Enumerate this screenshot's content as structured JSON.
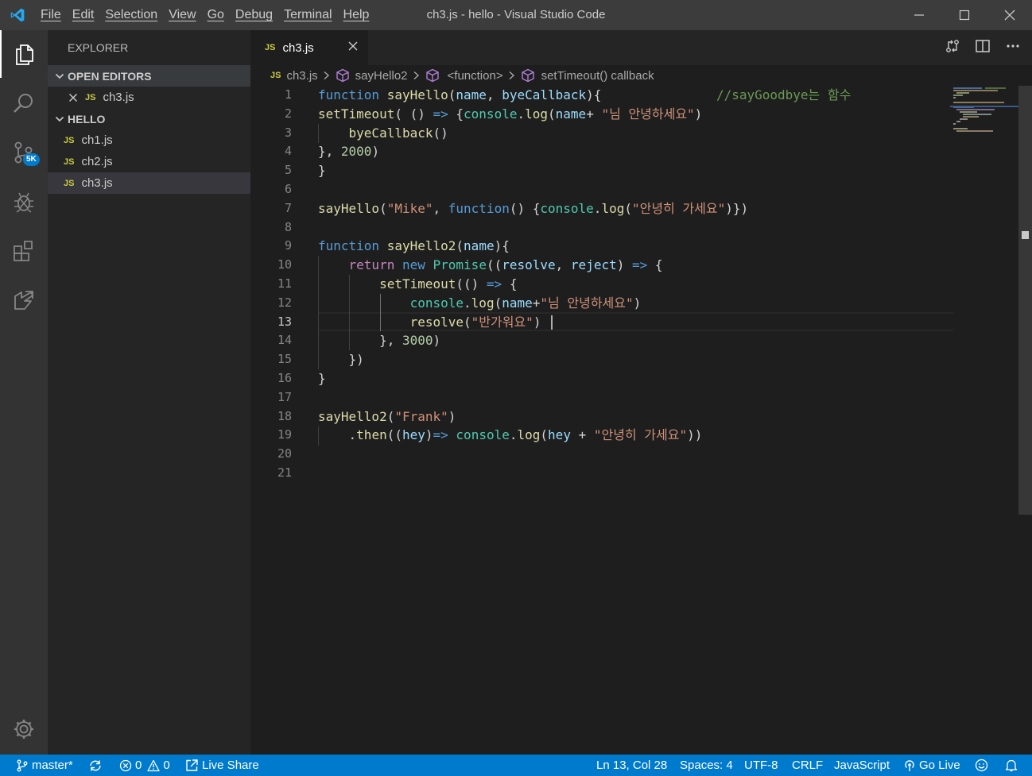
{
  "window": {
    "title": "ch3.js - hello - Visual Studio Code"
  },
  "menu": [
    "File",
    "Edit",
    "Selection",
    "View",
    "Go",
    "Debug",
    "Terminal",
    "Help"
  ],
  "activity": {
    "scm_badge": "5K"
  },
  "sidebar": {
    "title": "EXPLORER",
    "open_editors_label": "OPEN EDITORS",
    "open_editors": [
      {
        "badge": "JS",
        "name": "ch3.js"
      }
    ],
    "folder_label": "HELLO",
    "files": [
      {
        "badge": "JS",
        "name": "ch1.js"
      },
      {
        "badge": "JS",
        "name": "ch2.js"
      },
      {
        "badge": "JS",
        "name": "ch3.js"
      }
    ]
  },
  "tab": {
    "badge": "JS",
    "label": "ch3.js"
  },
  "breadcrumb": {
    "file": "ch3.js",
    "items": [
      "sayHello2",
      "<function>",
      "setTimeout() callback"
    ]
  },
  "editor": {
    "line_numbers": [
      "1",
      "2",
      "3",
      "4",
      "5",
      "6",
      "7",
      "8",
      "9",
      "10",
      "11",
      "12",
      "13",
      "14",
      "15",
      "16",
      "17",
      "18",
      "19",
      "20",
      "21"
    ],
    "lines": [
      [
        [
          "k",
          "function"
        ],
        [
          "w",
          " "
        ],
        [
          "f",
          "sayHello"
        ],
        [
          "w",
          "("
        ],
        [
          "p",
          "name"
        ],
        [
          "w",
          ", "
        ],
        [
          "p",
          "byeCallback"
        ],
        [
          "w",
          "){"
        ],
        [
          "w",
          "               "
        ],
        [
          "c",
          "//sayGoodbye는 함수"
        ]
      ],
      [
        [
          "f",
          "setTimeout"
        ],
        [
          "w",
          "( () "
        ],
        [
          "k",
          "=>"
        ],
        [
          "w",
          " {"
        ],
        [
          "t",
          "console"
        ],
        [
          "w",
          "."
        ],
        [
          "f",
          "log"
        ],
        [
          "w",
          "("
        ],
        [
          "p",
          "name"
        ],
        [
          "w",
          "+ "
        ],
        [
          "s",
          "\"님 안녕하세요\""
        ],
        [
          "w",
          ")"
        ]
      ],
      [
        [
          "w",
          "    "
        ],
        [
          "f",
          "byeCallback"
        ],
        [
          "w",
          "()"
        ]
      ],
      [
        [
          "w",
          "}, "
        ],
        [
          "n",
          "2000"
        ],
        [
          "w",
          ")"
        ]
      ],
      [
        [
          "w",
          "}"
        ]
      ],
      [],
      [
        [
          "f",
          "sayHello"
        ],
        [
          "w",
          "("
        ],
        [
          "s",
          "\"Mike\""
        ],
        [
          "w",
          ", "
        ],
        [
          "k",
          "function"
        ],
        [
          "w",
          "() {"
        ],
        [
          "t",
          "console"
        ],
        [
          "w",
          "."
        ],
        [
          "f",
          "log"
        ],
        [
          "w",
          "("
        ],
        [
          "s",
          "\"안녕히 가세요\""
        ],
        [
          "w",
          ")})"
        ]
      ],
      [],
      [
        [
          "k",
          "function"
        ],
        [
          "w",
          " "
        ],
        [
          "f",
          "sayHello2"
        ],
        [
          "w",
          "("
        ],
        [
          "p",
          "name"
        ],
        [
          "w",
          "){"
        ]
      ],
      [
        [
          "w",
          "    "
        ],
        [
          "kw",
          "return"
        ],
        [
          "w",
          " "
        ],
        [
          "k",
          "new"
        ],
        [
          "w",
          " "
        ],
        [
          "t",
          "Promise"
        ],
        [
          "w",
          "(("
        ],
        [
          "p",
          "resolve"
        ],
        [
          "w",
          ", "
        ],
        [
          "p",
          "reject"
        ],
        [
          "w",
          ") "
        ],
        [
          "k",
          "=>"
        ],
        [
          "w",
          " {"
        ]
      ],
      [
        [
          "w",
          "        "
        ],
        [
          "f",
          "setTimeout"
        ],
        [
          "w",
          "(() "
        ],
        [
          "k",
          "=>"
        ],
        [
          "w",
          " {"
        ]
      ],
      [
        [
          "w",
          "            "
        ],
        [
          "t",
          "console"
        ],
        [
          "w",
          "."
        ],
        [
          "f",
          "log"
        ],
        [
          "w",
          "("
        ],
        [
          "p",
          "name"
        ],
        [
          "w",
          "+"
        ],
        [
          "s",
          "\"님 안녕하세요\""
        ],
        [
          "w",
          ")"
        ]
      ],
      [
        [
          "w",
          "            "
        ],
        [
          "f",
          "resolve"
        ],
        [
          "w",
          "("
        ],
        [
          "s",
          "\"반가워요\""
        ],
        [
          "w",
          ")"
        ]
      ],
      [
        [
          "w",
          "        }, "
        ],
        [
          "n",
          "3000"
        ],
        [
          "w",
          ")"
        ]
      ],
      [
        [
          "w",
          "    })"
        ]
      ],
      [
        [
          "w",
          "}"
        ]
      ],
      [],
      [
        [
          "f",
          "sayHello2"
        ],
        [
          "w",
          "("
        ],
        [
          "s",
          "\"Frank\""
        ],
        [
          "w",
          ")"
        ]
      ],
      [
        [
          "w",
          "    ."
        ],
        [
          "f",
          "then"
        ],
        [
          "w",
          "(("
        ],
        [
          "p",
          "hey"
        ],
        [
          "w",
          ")"
        ],
        [
          "k",
          "=>"
        ],
        [
          "w",
          " "
        ],
        [
          "t",
          "console"
        ],
        [
          "w",
          "."
        ],
        [
          "f",
          "log"
        ],
        [
          "w",
          "("
        ],
        [
          "p",
          "hey"
        ],
        [
          "w",
          " + "
        ],
        [
          "s",
          "\"안녕히 가세요\""
        ],
        [
          "w",
          "))"
        ]
      ],
      [],
      []
    ]
  },
  "status": {
    "branch": "master*",
    "errors": "0",
    "warnings": "0",
    "live_share": "Live Share",
    "position": "Ln 13, Col 28",
    "spaces": "Spaces: 4",
    "encoding": "UTF-8",
    "eol": "CRLF",
    "language": "JavaScript",
    "go_live": "Go Live"
  },
  "colors": {
    "accent": "#007acc",
    "titlebar": "#3c3c3c",
    "sidebar": "#252526",
    "editor": "#1e1e1e"
  }
}
